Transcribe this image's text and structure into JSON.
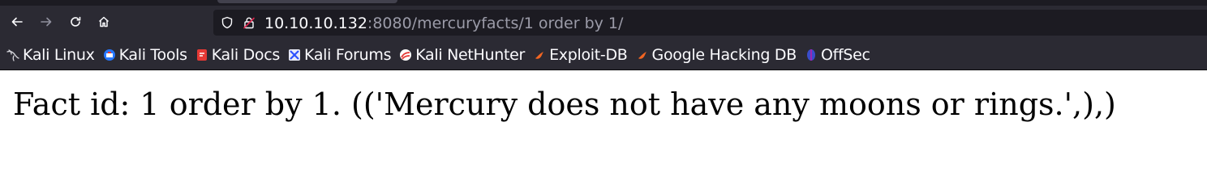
{
  "browser": {
    "url": {
      "host": "10.10.10.132",
      "rest": ":8080/mercuryfacts/1 order by 1/"
    },
    "nav": {
      "back_icon": "back-arrow-icon",
      "forward_icon": "forward-arrow-icon",
      "reload_icon": "reload-icon",
      "home_icon": "home-icon"
    },
    "bookmarks": [
      {
        "label": "Kali Linux",
        "icon": "kali-dragon-icon"
      },
      {
        "label": "Kali Tools",
        "icon": "kali-tools-icon"
      },
      {
        "label": "Kali Docs",
        "icon": "kali-docs-icon"
      },
      {
        "label": "Kali Forums",
        "icon": "kali-forums-icon"
      },
      {
        "label": "Kali NetHunter",
        "icon": "kali-nethunter-icon"
      },
      {
        "label": "Exploit-DB",
        "icon": "exploit-db-icon"
      },
      {
        "label": "Google Hacking DB",
        "icon": "google-hacking-db-icon"
      },
      {
        "label": "OffSec",
        "icon": "offsec-icon"
      }
    ],
    "colors": {
      "toolbar_bg": "#2b2a33",
      "urlbar_bg": "#1c1b22",
      "text": "#fbfbfe",
      "url_dim": "#9b9ba8"
    }
  },
  "page": {
    "fact_text": "Fact id: 1 order by 1. (('Mercury does not have any moons or rings.',),)"
  }
}
